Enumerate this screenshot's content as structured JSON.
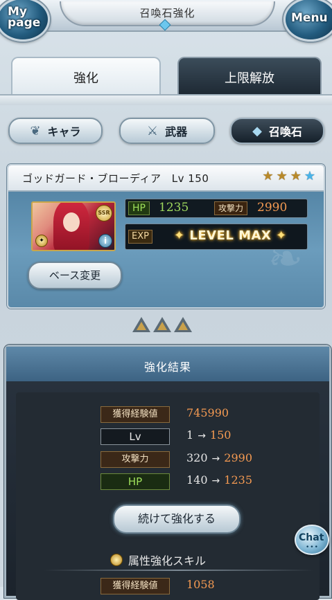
{
  "header": {
    "title": "召喚石強化",
    "mypage_label_line1": "My",
    "mypage_label_line2": "page",
    "menu_label": "Menu"
  },
  "tabs": [
    {
      "label": "強化",
      "active": true
    },
    {
      "label": "上限解放",
      "active": false
    }
  ],
  "categories": [
    {
      "label": "キャラ",
      "icon": "character-icon",
      "selected": false
    },
    {
      "label": "武器",
      "icon": "weapon-icon",
      "selected": false
    },
    {
      "label": "召喚石",
      "icon": "crystal-icon",
      "selected": true
    }
  ],
  "summon": {
    "name": "ゴッドガード・ブローディア",
    "level_text": "Lv 150",
    "rarity": "SSR",
    "stars": [
      "gold",
      "gold",
      "gold",
      "blue"
    ],
    "hp_label": "HP",
    "hp": "1235",
    "atk_label": "攻撃力",
    "atk": "2990",
    "exp_label": "EXP",
    "exp_status": "LEVEL MAX",
    "base_change_label": "ベース変更"
  },
  "result": {
    "title": "強化結果",
    "rows": [
      {
        "label": "獲得経験値",
        "value": "745990"
      },
      {
        "label": "Lv",
        "from": "1",
        "to": "150"
      },
      {
        "label": "攻撃力",
        "from": "320",
        "to": "2990"
      },
      {
        "label": "HP",
        "from": "140",
        "to": "1235"
      }
    ],
    "arrow": "→",
    "continue_label": "続けて強化する",
    "skill_title": "属性強化スキル",
    "skill_row": {
      "label": "獲得経験値",
      "value": "1058"
    }
  },
  "chat": {
    "label": "Chat",
    "dots": "•••"
  },
  "colors": {
    "hp_green": "#9ed85d",
    "value_orange": "#f49a52",
    "panel_blue": "#5e88a8"
  }
}
